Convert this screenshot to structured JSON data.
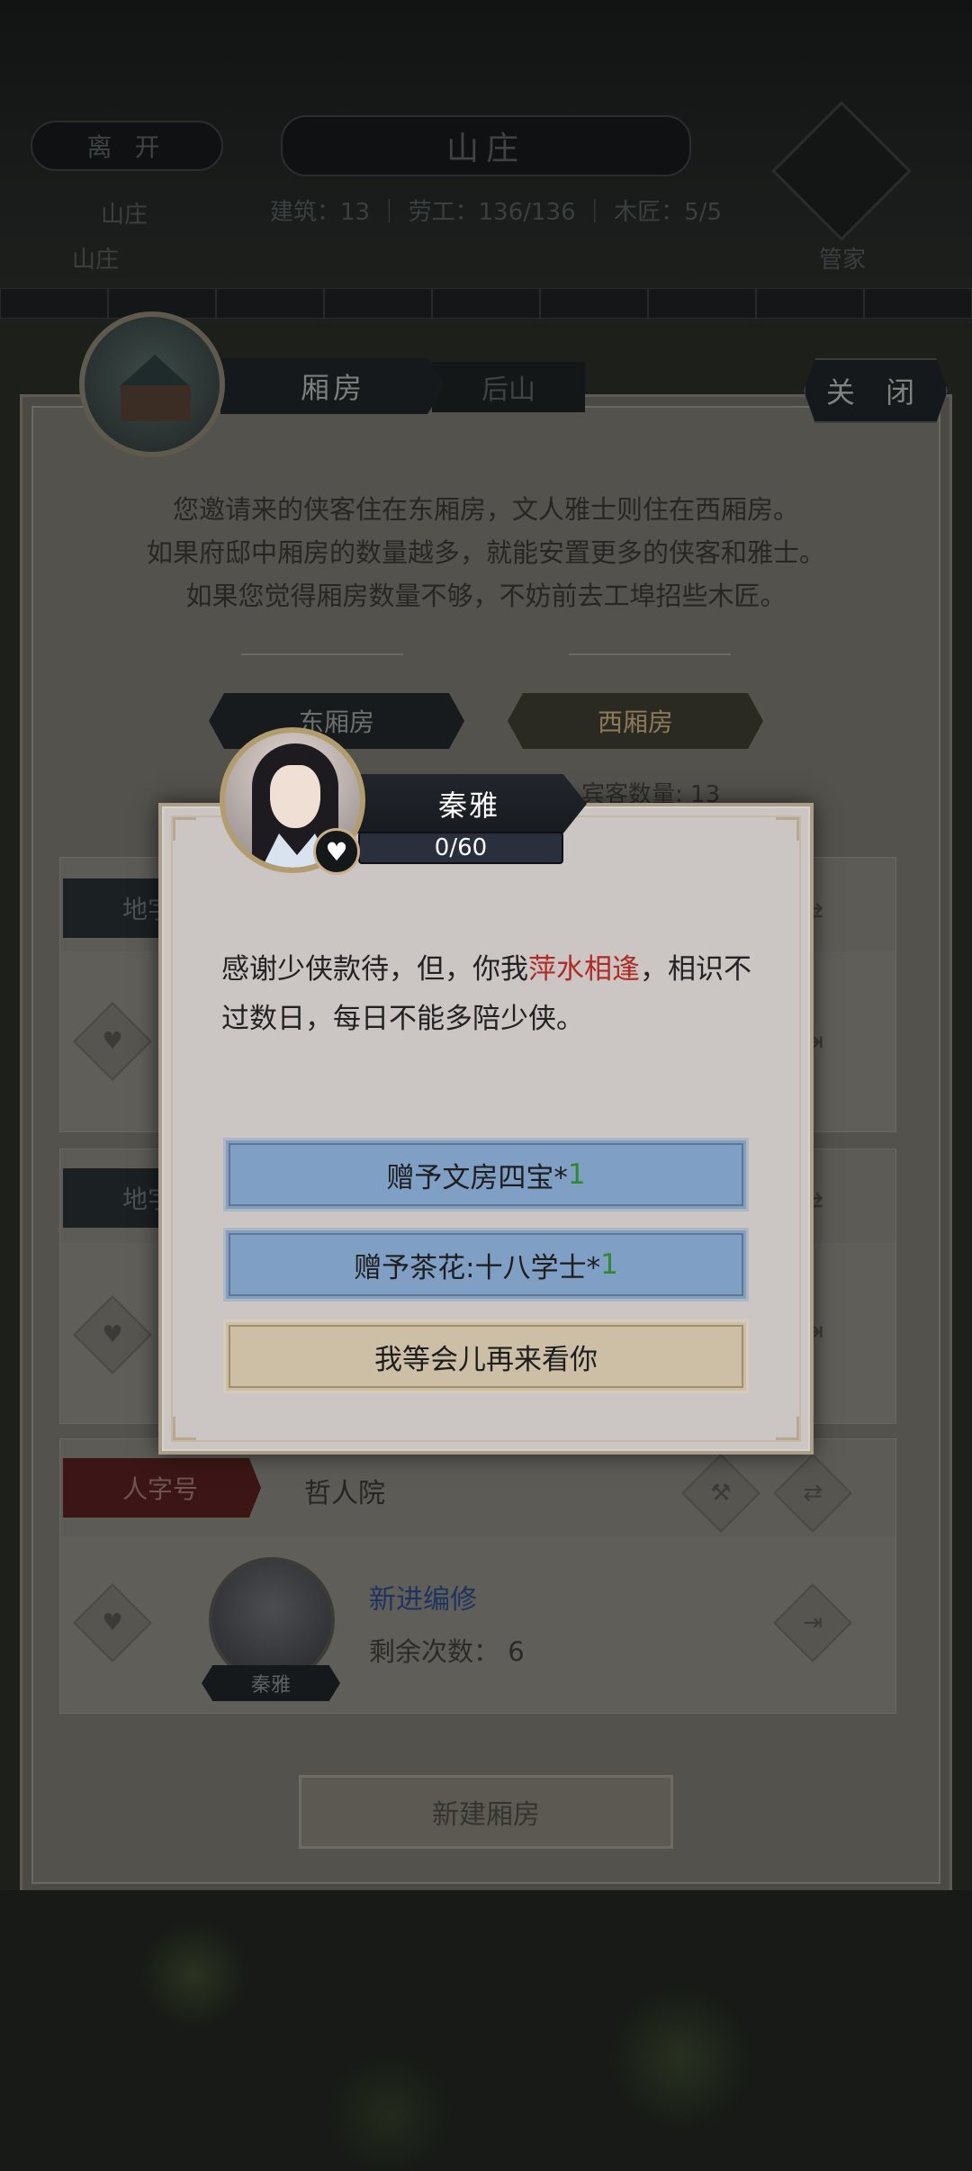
{
  "top_bar": {
    "leave_label": "离 开",
    "location_title": "山庄",
    "stats": "建筑：13 ｜ 劳工：136/136 ｜ 木匠：5/5",
    "left_sub_1": "山庄",
    "left_sub_2": "山庄",
    "steward_label": "管家"
  },
  "panel": {
    "title": "厢房",
    "second_tab": "后山",
    "close_label": "关 闭",
    "description": [
      "您邀请来的侠客住在东厢房，文人雅士则住在西厢房。",
      "如果府邸中厢房的数量越多，就能安置更多的侠客和雅士。",
      "如果您觉得厢房数量不够，不妨前去工埠招些木匠。"
    ],
    "tabs": [
      "东厢房",
      "西厢房"
    ],
    "guest_count": "宾客数量: 13",
    "cards": [
      {
        "tag": "地字"
      },
      {
        "tag": "地字"
      },
      {
        "tag": "人字号",
        "hall": "哲人院",
        "resident": {
          "name": "秦雅",
          "title": "新进编修",
          "remaining": "剩余次数： 6"
        }
      }
    ],
    "new_room_label": "新建厢房"
  },
  "dialog": {
    "npc_name": "秦雅",
    "affection": "0/60",
    "affection_fraction": 0,
    "text_before": "感谢少侠款待，但，你我",
    "text_highlight": "萍水相逢",
    "text_after": "，相识不过数日，每日不能多陪少侠。",
    "options": [
      {
        "label": "赠予文房四宝*",
        "qty": "1"
      },
      {
        "label": "赠予茶花:十八学士*",
        "qty": "1"
      },
      {
        "label": "我等会儿再来看你"
      }
    ]
  },
  "colors": {
    "highlight_text": "#b02a25",
    "option_blue": "#7fa0c4",
    "option_beige": "#ccbfa6",
    "qty_green": "#2f8a2f",
    "link_blue": "#1d3360"
  },
  "icons": [
    "heart-icon",
    "hammer-icon",
    "swap-icon",
    "exit-icon",
    "steward-icon",
    "house-icon"
  ]
}
